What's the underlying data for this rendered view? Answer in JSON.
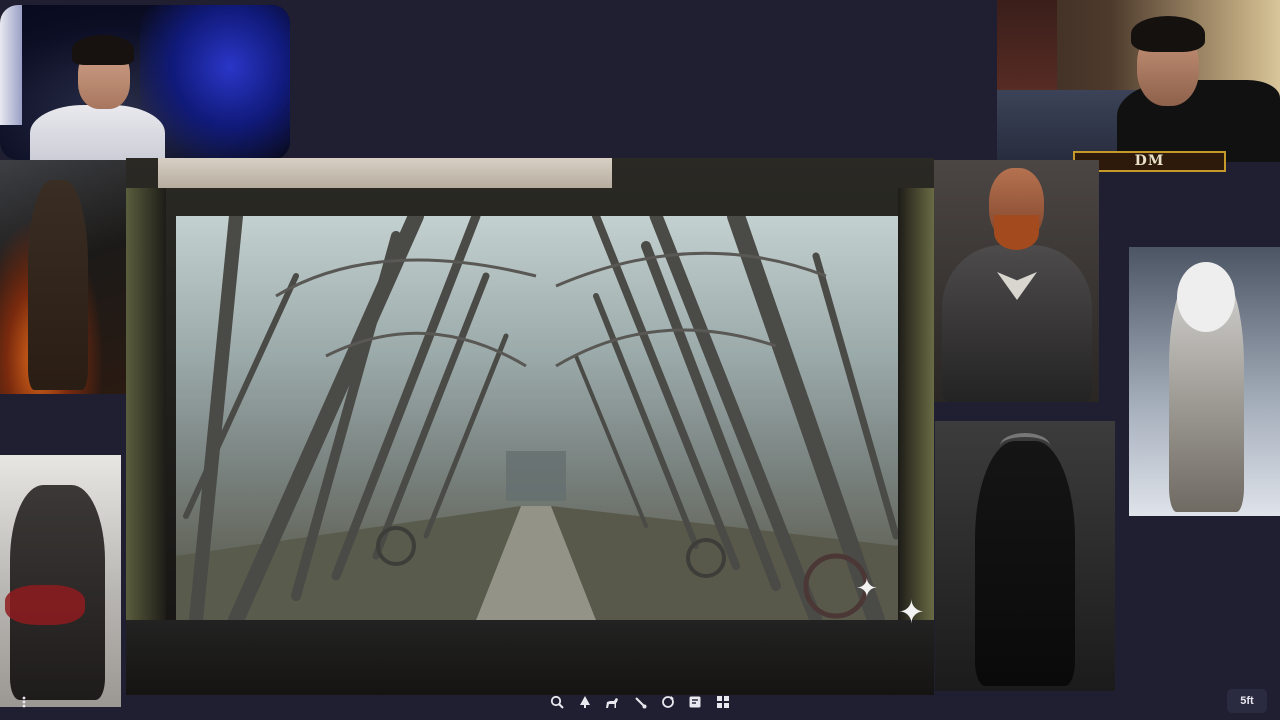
{
  "webcams": {
    "player": {
      "name": "player-webcam"
    },
    "dm": {
      "badge": "DM"
    }
  },
  "scene": {
    "description_icon": "landscape-image",
    "sparkle_icons": [
      "sparkle-icon",
      "sparkle-icon"
    ]
  },
  "toolbar": {
    "items": [
      {
        "icon": "search-icon"
      },
      {
        "icon": "tree-icon"
      },
      {
        "icon": "horse-icon"
      },
      {
        "icon": "brush-icon"
      },
      {
        "icon": "refresh-icon"
      },
      {
        "icon": "note-icon"
      },
      {
        "icon": "grid-icon"
      }
    ]
  },
  "grid_scale": {
    "label": "5ft"
  },
  "menu": {
    "icon": "more-vertical-icon"
  },
  "colors": {
    "background": "#1f1f31",
    "dm_border": "#c69a2a",
    "dm_fill": "#2d1a0a"
  }
}
